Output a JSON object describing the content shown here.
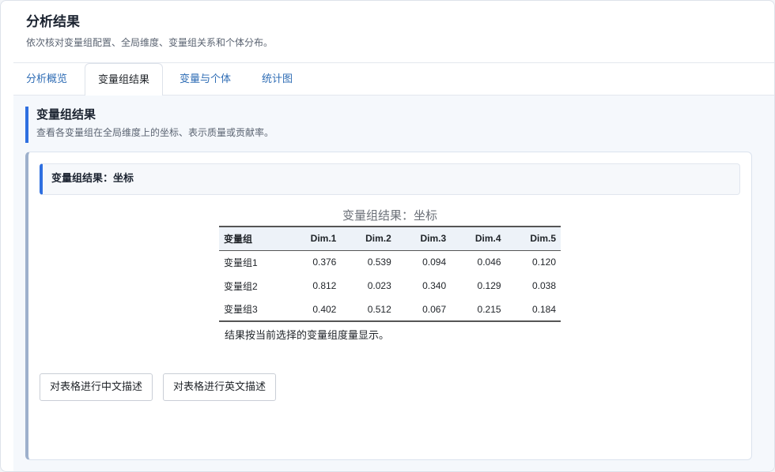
{
  "header": {
    "title": "分析结果",
    "subtitle": "依次核对变量组配置、全局维度、变量组关系和个体分布。"
  },
  "tabs": [
    {
      "label": "分析概览",
      "active": false
    },
    {
      "label": "变量组结果",
      "active": true
    },
    {
      "label": "变量与个体",
      "active": false
    },
    {
      "label": "统计图",
      "active": false
    }
  ],
  "section": {
    "title": "变量组结果",
    "description": "查看各变量组在全局维度上的坐标、表示质量或贡献率。"
  },
  "card": {
    "title": "变量组结果：坐标"
  },
  "table": {
    "caption": "变量组结果：坐标",
    "columns": [
      "变量组",
      "Dim.1",
      "Dim.2",
      "Dim.3",
      "Dim.4",
      "Dim.5"
    ],
    "rows": [
      [
        "变量组1",
        "0.376",
        "0.539",
        "0.094",
        "0.046",
        "0.120"
      ],
      [
        "变量组2",
        "0.812",
        "0.023",
        "0.340",
        "0.129",
        "0.038"
      ],
      [
        "变量组3",
        "0.402",
        "0.512",
        "0.067",
        "0.215",
        "0.184"
      ]
    ],
    "note": "结果按当前选择的变量组度量显示。"
  },
  "buttons": {
    "describe_zh": "对表格进行中文描述",
    "describe_en": "对表格进行英文描述"
  },
  "colors": {
    "accent": "#2f6fe0",
    "tab_link": "#2f6db5"
  }
}
